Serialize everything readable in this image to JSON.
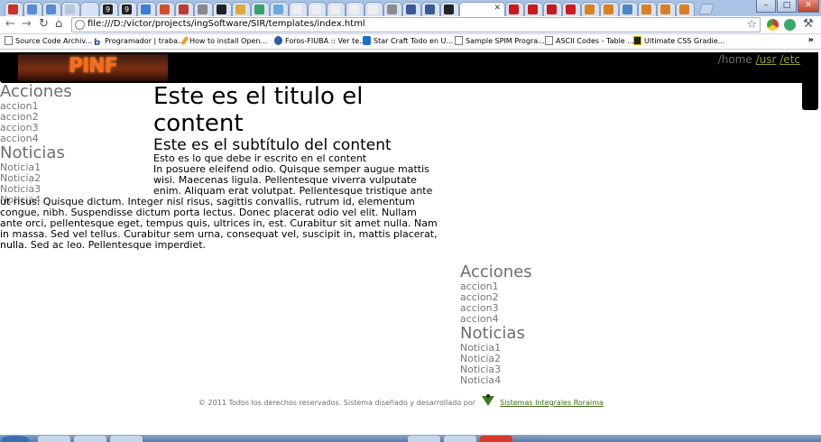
{
  "browser": {
    "tab_favicon_colors": [
      "#cc3322",
      "#5a8ad2",
      "#5a8ad2",
      "#b7c7dd",
      "#d7e2f2",
      "#222222",
      "#222222",
      "#3b7ed4",
      "#d74d29",
      "#c13b33",
      "#888888",
      "#222222",
      "#e0a73a",
      "#3b9f6b",
      "#6aa9e2",
      "#eeeeee",
      "#eeeeee",
      "#eeeeee",
      "#eeeeee",
      "#eeeeee",
      "#8a8a8a",
      "#3b5998",
      "#3b5998",
      "#222222",
      "#ffffff",
      "#cc1a1a",
      "#cc1a1a",
      "#cc1a1a",
      "#cc1a1a",
      "#d9801f",
      "#d9801f",
      "#4b86c6",
      "#d9801f",
      "#d9801f",
      "#d9801f"
    ],
    "tab_text_9a": "9",
    "tab_text_9b": "9",
    "nav": {
      "back_icon": "back-arrow-icon",
      "forward_icon": "forward-arrow-icon",
      "reload_icon": "reload-icon",
      "home_icon": "home-icon"
    },
    "address_url": "file:///D:/victor/projects/ingSoftware/SIR/templates/index.html",
    "bookmarks": [
      {
        "label": "Source Code Archiv...",
        "icon": "page"
      },
      {
        "label": "Programador | traba...",
        "icon": "b"
      },
      {
        "label": "How to install Open...",
        "icon": "pen"
      },
      {
        "label": "Foros-FIUBA :: Ver te...",
        "icon": "globe"
      },
      {
        "label": "Star Craft Todo en U...",
        "icon": "blue"
      },
      {
        "label": "Sample SPIM Progra...",
        "icon": "page"
      },
      {
        "label": "ASCII Codes - Table ...",
        "icon": "page"
      },
      {
        "label": "Ultimate CSS Gradie...",
        "icon": "dark"
      }
    ],
    "bookmarks_more": "»"
  },
  "site": {
    "logo_text": "PINF",
    "breadcrumb": {
      "current": "/home",
      "link1": "/usr",
      "link2": "/etc"
    },
    "sidebar_left": {
      "acciones_title": "Acciones",
      "acciones": [
        "accion1",
        "accion2",
        "accion3",
        "accion4"
      ],
      "noticias_title": "Noticias",
      "noticias": [
        "Noticia1",
        "Noticia2",
        "Noticia3",
        "Noticia4"
      ]
    },
    "content": {
      "title": "Este es el titulo el content",
      "subtitle": "Este es el subtítulo del content",
      "lead": "Esto es lo que debe ir escrito en el content",
      "body": "In posuere eleifend odio. Quisque semper augue mattis wisi. Maecenas ligula. Pellentesque viverra vulputate enim. Aliquam erat volutpat. Pellentesque tristique ante ut risus. Quisque dictum. Integer nisl risus, sagittis convallis, rutrum id, elementum congue, nibh. Suspendisse dictum porta lectus. Donec placerat odio vel elit. Nullam ante orci, pellentesque eget, tempus quis, ultrices in, est. Curabitur sit amet nulla. Nam in massa. Sed vel tellus. Curabitur sem urna, consequat vel, suscipit in, mattis placerat, nulla. Sed ac leo. Pellentesque imperdiet."
    },
    "sidebar_right": {
      "acciones_title": "Acciones",
      "acciones": [
        "accion1",
        "accion2",
        "accion3",
        "accion4"
      ],
      "noticias_title": "Noticias",
      "noticias": [
        "Noticia1",
        "Noticia2",
        "Noticia3",
        "Noticia4"
      ]
    },
    "footer": {
      "text": "© 2011 Todos los derechos reservados. Sistema diseñado y desarrollado por",
      "link": "Sistemas Integrales Roraima"
    },
    "colors": {
      "header_bg": "#000000",
      "link_green": "#8fa023",
      "sidebar_gray": "#777777",
      "logo_orange": "#ff6a1a"
    }
  }
}
